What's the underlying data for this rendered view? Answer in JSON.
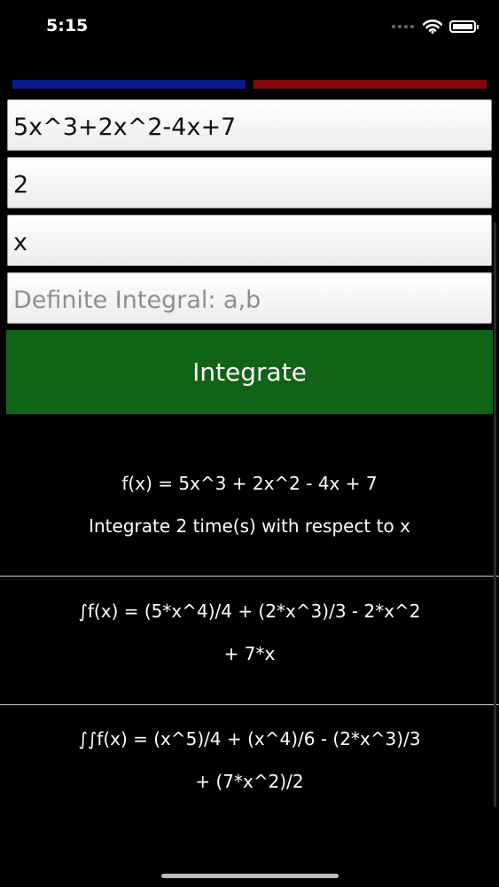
{
  "status_bar": {
    "time": "5:15"
  },
  "inputs": {
    "function_value": "5x^3+2x^2-4x+7",
    "times_value": "2",
    "variable_value": "x",
    "definite_placeholder": "Definite Integral: a,b"
  },
  "actions": {
    "integrate_label": "Integrate"
  },
  "results": {
    "function_line": "f(x) = 5x^3 + 2x^2 - 4x + 7",
    "description_line": "Integrate 2 time(s) with respect to x",
    "first_integral_line1": "∫f(x) = (5*x^4)/4 + (2*x^3)/3 - 2*x^2",
    "first_integral_line2": "+ 7*x",
    "second_integral_line1": "∫∫f(x) = (x^5)/4 + (x^4)/6 - (2*x^3)/3",
    "second_integral_line2": "+ (7*x^2)/2"
  },
  "colors": {
    "background": "#000000",
    "bar_blue": "#0f1a8a",
    "bar_red": "#7d0b0b",
    "button_green": "#116316"
  },
  "icons": [
    "signal-dots-icon",
    "wifi-icon",
    "battery-icon"
  ]
}
